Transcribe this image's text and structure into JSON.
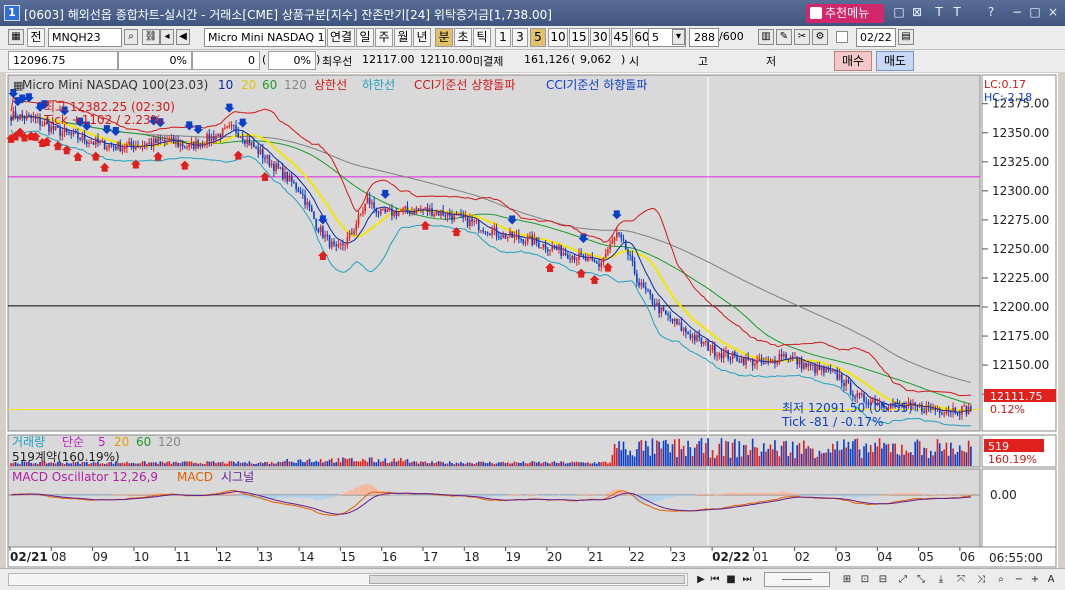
{
  "window": {
    "number": "1",
    "title": "[0603] 해외선옵 종합차트-실시간 - 거래소[CME] 상품구분[지수] 잔존만기[24] 위탁증거금[1,738.00]",
    "recommend_label": "추천메뉴",
    "controls": [
      "□",
      "⊠",
      "T",
      "T",
      "?",
      "−",
      "□",
      "×"
    ]
  },
  "toolbar": {
    "prefix_label": "전",
    "symbol_code": "MNQH23",
    "symbol_name": "Micro Mini NASDAQ 100",
    "periods": [
      "연결",
      "일",
      "주",
      "월",
      "년",
      "분",
      "초",
      "틱",
      "1",
      "3",
      "5",
      "10",
      "15",
      "30",
      "45",
      "60"
    ],
    "selected_period": "분",
    "selected_interval": "5",
    "interval_value": "5",
    "count": "288",
    "count_total": "/600",
    "date": "02/22"
  },
  "quote": {
    "price": "12096.75",
    "pct1": "0%",
    "change": "0",
    "pct2": "0%",
    "best_label": "최우선",
    "best_ask": "12117.00",
    "best_bid": "12110.00",
    "oi_label": "미결제",
    "oi": "161,126",
    "oi_change": "9,062",
    "open_label": "시",
    "high_label": "고",
    "low_label": "저",
    "sell_label": "매수",
    "buy_label": "매도"
  },
  "legend": {
    "instrument": "Micro Mini NASDAQ 100(23.03)",
    "ma": [
      "10",
      "20",
      "60",
      "120"
    ],
    "upper": "상한선",
    "lower": "하한선",
    "cci_up": "CCI기준선 상향돌파",
    "cci_down": "CCI기준선 하향돌파",
    "lc": "LC:0.17",
    "hc": "HC:-2.18",
    "high_annot": "최고 12382.25 (02:30)",
    "high_pct": "Tick +1102 / 2.23%",
    "low_annot": "최저 12091.50 (05:55)",
    "low_pct": "Tick -81 / -0.17%",
    "last_price": "12111.75",
    "last_pct": "0.12%"
  },
  "volume_legend": {
    "label": "거래량",
    "ma_label": "단순",
    "ma": [
      "5",
      "20",
      "60",
      "120"
    ],
    "current": "519계약(160.19%)",
    "last_value": "519",
    "last_pct": "160.19%"
  },
  "macd_legend": {
    "osc": "MACD Oscillator 12,26,9",
    "macd": "MACD",
    "signal": "시그널",
    "zero": "0.00"
  },
  "colors": {
    "candle_up": "#e0201c",
    "candle_down": "#0c3fc8",
    "ma10": "#0a2a9a",
    "ma20": "#f4e600",
    "ma60": "#1c9c2c",
    "ma120": "#808080",
    "upper": "#d01818",
    "lower": "#21a2c0",
    "osc": "#ffb090",
    "osc_neg": "#a8d0f0",
    "macd": "#e06000",
    "signal": "#602090"
  },
  "chart_data": {
    "type": "candlestick",
    "y_axis": [
      "12375.00",
      "12350.00",
      "12325.00",
      "12300.00",
      "12275.00",
      "12250.00",
      "12225.00",
      "12200.00",
      "12175.00",
      "12150.00",
      "12125.00"
    ],
    "ylim": [
      12095,
      12398
    ],
    "x_labels": [
      "02/21",
      "08",
      "09",
      "10",
      "11",
      "12",
      "13",
      "14",
      "15",
      "16",
      "17",
      "18",
      "19",
      "20",
      "21",
      "22",
      "23",
      "02/22",
      "01",
      "02",
      "03",
      "04",
      "05",
      "06"
    ],
    "current_time": "06:55:00",
    "hline_magenta": 12312,
    "hline_black": 12201,
    "hline_yellow": 12111.75,
    "cci_down_arrows": [
      1,
      3,
      5,
      8,
      13,
      15,
      24,
      31,
      34,
      43,
      47,
      64,
      67,
      80,
      84,
      98,
      104,
      140,
      168,
      225,
      257,
      272
    ],
    "cci_up_arrows": [
      0,
      2,
      4,
      6,
      9,
      11,
      14,
      16,
      21,
      25,
      30,
      38,
      42,
      56,
      66,
      78,
      102,
      114,
      140,
      186,
      200,
      242,
      256,
      262,
      268
    ],
    "path": [
      [
        0,
        12365
      ],
      [
        10,
        12362
      ],
      [
        20,
        12352
      ],
      [
        30,
        12346
      ],
      [
        40,
        12340
      ],
      [
        50,
        12338
      ],
      [
        60,
        12340
      ],
      [
        70,
        12343
      ],
      [
        80,
        12338
      ],
      [
        90,
        12346
      ],
      [
        100,
        12354
      ],
      [
        110,
        12336
      ],
      [
        120,
        12318
      ],
      [
        130,
        12300
      ],
      [
        138,
        12268
      ],
      [
        146,
        12248
      ],
      [
        152,
        12260
      ],
      [
        160,
        12292
      ],
      [
        166,
        12280
      ],
      [
        174,
        12282
      ],
      [
        184,
        12284
      ],
      [
        196,
        12280
      ],
      [
        208,
        12272
      ],
      [
        220,
        12262
      ],
      [
        232,
        12258
      ],
      [
        244,
        12250
      ],
      [
        256,
        12242
      ],
      [
        264,
        12236
      ],
      [
        272,
        12262
      ],
      [
        276,
        12250
      ],
      [
        282,
        12220
      ],
      [
        292,
        12196
      ],
      [
        302,
        12180
      ],
      [
        316,
        12162
      ],
      [
        328,
        12155
      ],
      [
        340,
        12150
      ],
      [
        346,
        12160
      ],
      [
        356,
        12150
      ],
      [
        372,
        12140
      ],
      [
        380,
        12122
      ],
      [
        390,
        12118
      ],
      [
        400,
        12114
      ],
      [
        416,
        12112
      ],
      [
        431,
        12111.75
      ]
    ],
    "volume_max": 600,
    "macd_zero": 0
  }
}
